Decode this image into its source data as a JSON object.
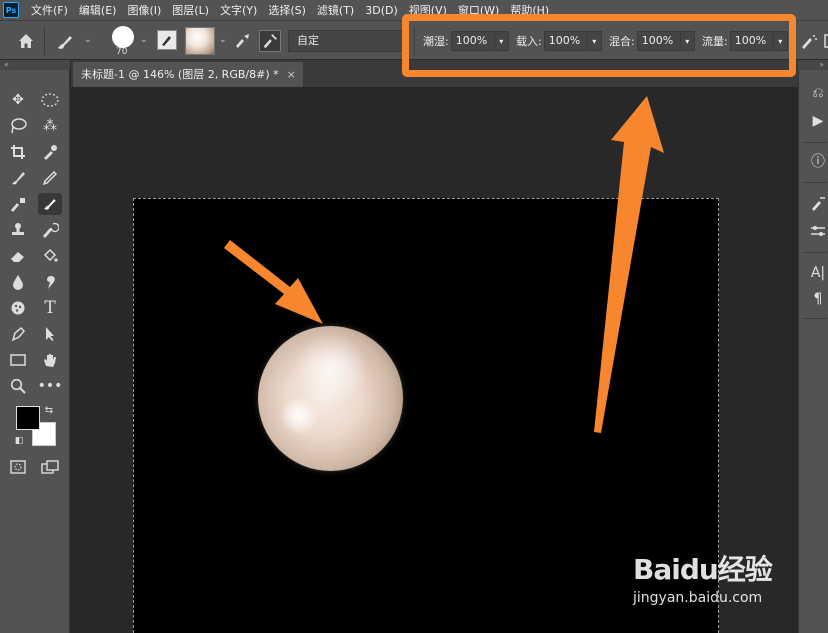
{
  "app": {
    "logo": "Ps"
  },
  "menu": [
    "文件(F)",
    "编辑(E)",
    "图像(I)",
    "图层(L)",
    "文字(Y)",
    "选择(S)",
    "滤镜(T)",
    "3D(D)",
    "视图(V)",
    "窗口(W)",
    "帮助(H)"
  ],
  "options": {
    "brush_size": "70",
    "preset": "自定",
    "wet_label": "潮湿:",
    "wet_value": "100%",
    "load_label": "载入:",
    "load_value": "100%",
    "mix_label": "混合:",
    "mix_value": "100%",
    "flow_label": "流量:",
    "flow_value": "100%"
  },
  "document": {
    "tab_title": "未标题-1 @ 146% (图层 2, RGB/8#) *",
    "close": "×"
  },
  "colors": {
    "foreground": "#000000",
    "background": "#ffffff",
    "highlight": "#f7862f"
  },
  "watermark": {
    "brand": "Baidu经验",
    "url": "jingyan.baidu.com"
  }
}
